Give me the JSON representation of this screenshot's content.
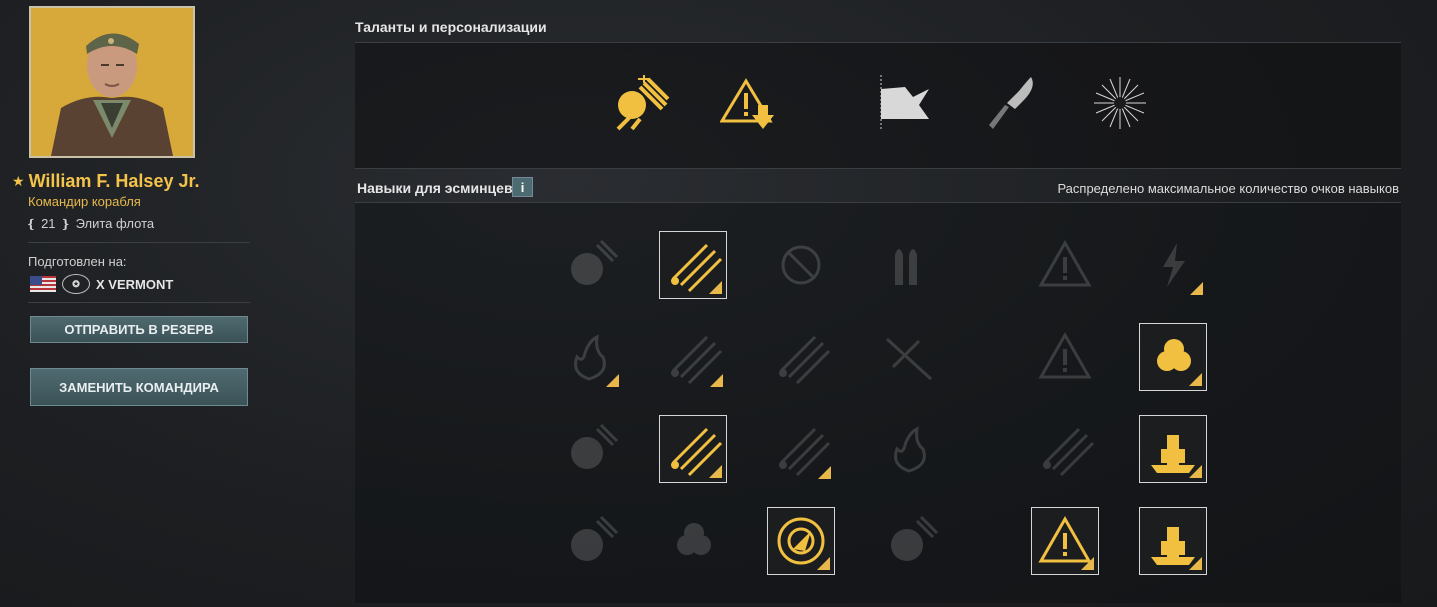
{
  "commander": {
    "name": "William F. Halsey Jr.",
    "role": "Командир корабля",
    "level": "21",
    "rank": "Элита флота",
    "trained_label": "Подготовлен на:",
    "ship": "X VERMONT"
  },
  "buttons": {
    "reserve": "ОТПРАВИТЬ В РЕЗЕРВ",
    "replace": "ЗАМЕНИТЬ КОМАНДИРА"
  },
  "talents": {
    "title": "Таланты и персонализации",
    "items": [
      "plane-gun-icon",
      "warning-down-icon",
      "flag-icon",
      "knife-icon",
      "firework-icon"
    ]
  },
  "skills": {
    "title": "Навыки для эсминцев",
    "info": "i",
    "note": "Распределено максимальное количество очков навыков",
    "rows": [
      [
        "consumables-icon",
        "torpedo-speed-icon",
        "blocked-icon",
        "shell-reload-icon",
        "ap-warning-icon",
        "striped-lightning-icon"
      ],
      [
        "fire-icon",
        "torpedo-reload-icon",
        "torpedo-tubes-icon",
        "aa-plane-icon",
        "target-warning-icon",
        "propulsion-icon"
      ],
      [
        "consumables-up-icon",
        "torpedo-reload-boost-icon",
        "crossed-torpedo-icon",
        "fire-plane-icon",
        "tubes-icon",
        "battleship-icon"
      ],
      [
        "consumables-up-icon-2",
        "fan-up-icon",
        "radar-icon",
        "smoke-icon",
        "warning-boost-icon",
        "ship-top-icon"
      ]
    ],
    "active": [
      [
        false,
        true,
        false,
        false,
        false,
        false
      ],
      [
        false,
        false,
        false,
        false,
        false,
        true
      ],
      [
        false,
        true,
        false,
        false,
        false,
        true
      ],
      [
        false,
        false,
        true,
        false,
        true,
        true
      ]
    ]
  },
  "colors": {
    "accent": "#e8b94a",
    "text": "#d9d9d9",
    "button": "#4a6469"
  }
}
